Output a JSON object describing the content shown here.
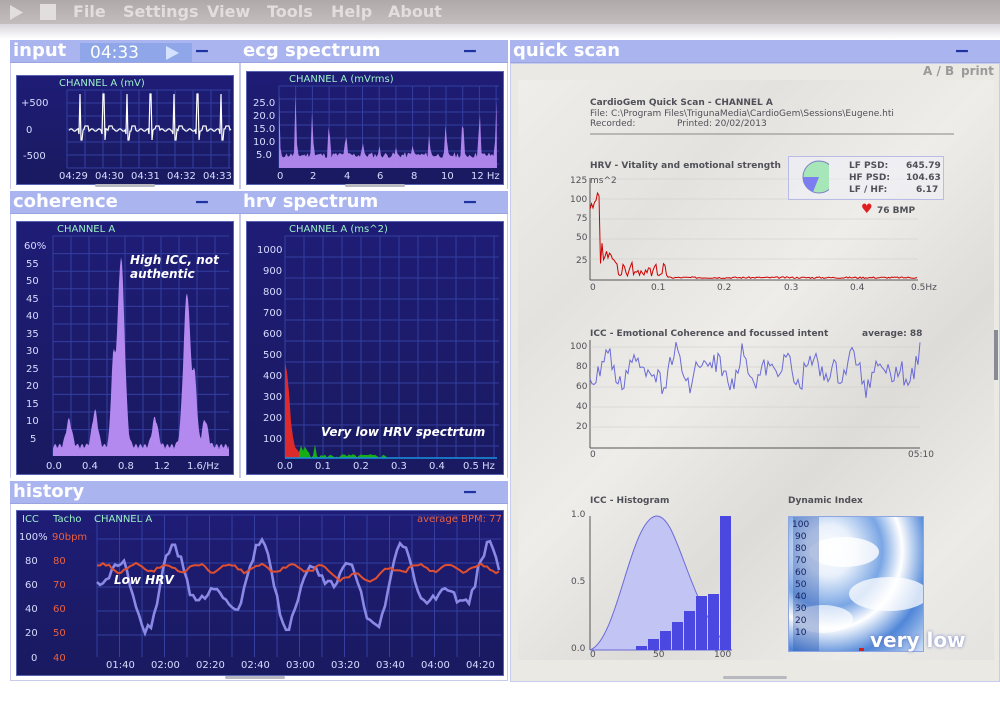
{
  "menu": {
    "items": [
      "File",
      "Settings",
      "View",
      "Tools",
      "Help",
      "About"
    ]
  },
  "panels": {
    "input": {
      "title": "input",
      "time": "04:33",
      "controls": "−+x",
      "channel": "CHANNEL A (mV)",
      "y_ticks": [
        "+500",
        "0",
        "-500"
      ],
      "x_ticks": [
        "04:29",
        "04:30",
        "04:31",
        "04:32",
        "04:33"
      ]
    },
    "ecg_spectrum": {
      "title": "ecg spectrum",
      "controls": "−+x",
      "channel": "CHANNEL A (mVrms)",
      "y_ticks": [
        "25.0",
        "20.0",
        "15.0",
        "10.0",
        "5.0"
      ],
      "x_ticks": [
        "0",
        "2",
        "4",
        "6",
        "8",
        "10",
        "12 Hz"
      ]
    },
    "coherence": {
      "title": "coherence",
      "controls": "−+x",
      "channel": "CHANNEL A",
      "y_ticks": [
        "60%",
        "55",
        "50",
        "45",
        "40",
        "35",
        "30",
        "25",
        "20",
        "15",
        "10",
        "5"
      ],
      "x_ticks": [
        "0.0",
        "0.4",
        "0.8",
        "1.2",
        "1.6/Hz"
      ],
      "note_line1": "High ICC, not",
      "note_line2": "authentic"
    },
    "hrv_spectrum": {
      "title": "hrv spectrum",
      "controls": "−+x",
      "channel": "CHANNEL A (ms^2)",
      "y_ticks": [
        "1000",
        "900",
        "800",
        "700",
        "600",
        "500",
        "400",
        "300",
        "200",
        "100"
      ],
      "x_ticks": [
        "0.0",
        "0.1",
        "0.2",
        "0.3",
        "0.4",
        "0.5 Hz"
      ],
      "note": "Very low HRV spectrtum"
    },
    "history": {
      "title": "history",
      "controls": "−+x",
      "col_icc": "ICC",
      "col_tacho": "Tacho",
      "channel": "CHANNEL A",
      "average": "average BPM: 77",
      "icc_ticks": [
        "100%",
        "80",
        "60",
        "40",
        "20",
        "0"
      ],
      "tacho_ticks": [
        "90bpm",
        "80",
        "70",
        "60",
        "50",
        "40"
      ],
      "x_ticks": [
        "01:40",
        "02:00",
        "02:20",
        "02:40",
        "03:00",
        "03:20",
        "03:40",
        "04:00",
        "04:20"
      ],
      "note": "Low HRV"
    },
    "quick_scan": {
      "title": "quick scan",
      "controls": "−+x",
      "ab": "A / B",
      "print": "print",
      "report_title": "CardioGem Quick Scan - CHANNEL A",
      "file": "File: C:\\Program Files\\TrigunaMedia\\CardioGem\\Sessions\\Eugene.hti",
      "recorded": "Recorded:",
      "printed": "Printed: 20/02/2013",
      "hrv_title": "HRV - Vitality and emotional strength",
      "hrv_unit": "ms^2",
      "hrv_y": [
        "125",
        "100",
        "75",
        "50",
        "25"
      ],
      "hrv_x": [
        "0",
        "0.1",
        "0.2",
        "0.3",
        "0.4",
        "0.5Hz"
      ],
      "lf_label": "LF PSD:",
      "lf_val": "645.79",
      "hf_label": "HF PSD:",
      "hf_val": "104.63",
      "ratio_label": "LF / HF:",
      "ratio_val": "6.17",
      "bmp": "76 BMP",
      "icc_title": "ICC - Emotional Coherence and focussed intent",
      "icc_avg": "average: 88",
      "icc_y": [
        "100",
        "80",
        "60",
        "40",
        "20"
      ],
      "icc_x0": "0",
      "icc_x1": "05:10",
      "hist_title": "ICC - Histogram",
      "hist_y": [
        "1.0",
        "0.5",
        "0.0"
      ],
      "hist_x": [
        "0",
        "50",
        "100"
      ],
      "dyn_title": "Dynamic Index",
      "dyn_y": [
        "100",
        "90",
        "80",
        "70",
        "60",
        "50",
        "40",
        "30",
        "20",
        "10"
      ],
      "dyn_label": "very low"
    }
  },
  "colors": {
    "header_bg": "#aab4ee",
    "plot_bg": "#1e1c76",
    "spectrum_fill": "#b389f0",
    "ecg_trace": "#ffffff",
    "tacho_line": "#e05030",
    "icc_line": "#8a8ae6",
    "lf_line": "#cc0000",
    "hf_fill": "#00aa00"
  }
}
